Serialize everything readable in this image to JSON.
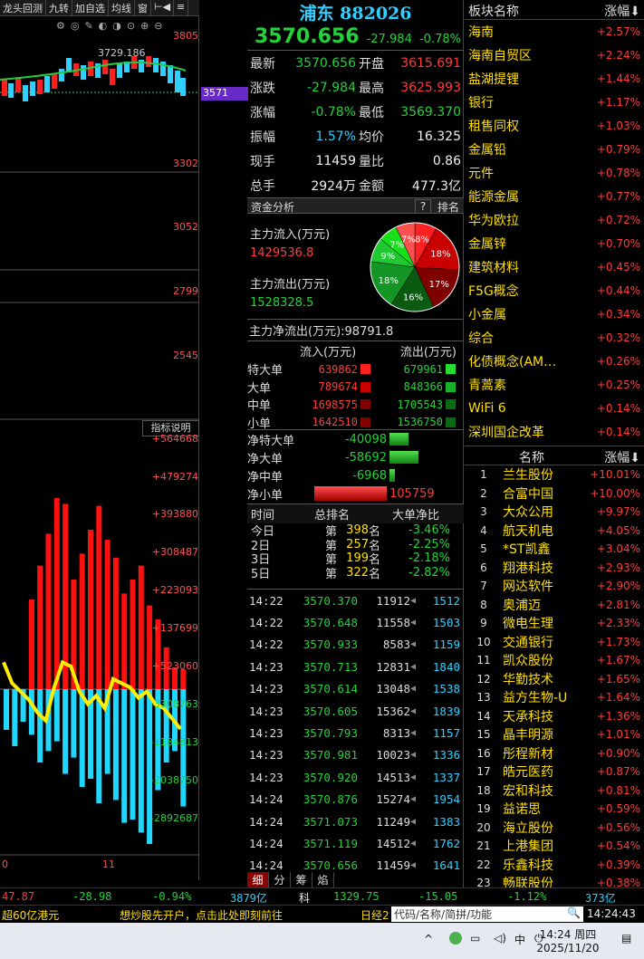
{
  "menu": {
    "items": [
      "龙头回测",
      "九转",
      "加自选",
      "均线",
      "窗",
      "⊢◀",
      "≡"
    ]
  },
  "chart": {
    "price_labels": [
      "3805",
      "3571",
      "3302",
      "3052",
      "2799",
      "2545"
    ],
    "current_tag": "3571",
    "high_label": "3729.186",
    "indicator_btn": "指标说明",
    "flow_labels": [
      "+564668",
      "+479274",
      "+393880",
      "+308487",
      "+223093",
      "+137699",
      "+523060",
      "-3308763",
      "-1184813",
      "-2038750",
      "-2892687"
    ],
    "x_labels": [
      "0",
      "11"
    ],
    "bars": [
      0,
      0,
      0,
      0.45,
      0.62,
      0.78,
      0.96,
      0.93,
      0.55,
      0.68,
      0.8,
      0.92,
      0.75,
      0.66,
      0.48,
      0.55,
      0.62,
      0.42,
      0.35,
      0.21,
      0.11,
      0.1
    ],
    "cbars": [
      0.25,
      0.35,
      0.2,
      0.28,
      0.45,
      0.38,
      0.32,
      0.52,
      0.42,
      0.6,
      0.55,
      0.7,
      0.52,
      0.68,
      0.82,
      0.8,
      0.88,
      0.95,
      0.62,
      0.45,
      0.38,
      0.72
    ],
    "yline": [
      0.58,
      0.68,
      0.72,
      0.76,
      0.82,
      0.86,
      0.7,
      0.58,
      0.6,
      0.72,
      0.78,
      0.74,
      0.8,
      0.66,
      0.68,
      0.7,
      0.75,
      0.72,
      0.78,
      0.8,
      0.85,
      0.9
    ]
  },
  "stock": {
    "name": "浦东",
    "code": "882026",
    "price": "3570.656",
    "change": "-27.984",
    "pct": "-0.78%"
  },
  "quote": [
    {
      "l1": "最新",
      "v1": "3570.656",
      "c1": "green",
      "l2": "开盘",
      "v2": "3615.691",
      "c2": "red"
    },
    {
      "l1": "涨跌",
      "v1": "-27.984",
      "c1": "green",
      "l2": "最高",
      "v2": "3625.993",
      "c2": "red"
    },
    {
      "l1": "涨幅",
      "v1": "-0.78%",
      "c1": "green",
      "l2": "最低",
      "v2": "3569.370",
      "c2": "green"
    },
    {
      "l1": "振幅",
      "v1": "1.57%",
      "c1": "cyan",
      "l2": "均价",
      "v2": "16.325",
      "c2": "white"
    },
    {
      "l1": "现手",
      "v1": "11459",
      "c1": "white",
      "l2": "量比",
      "v2": "0.86",
      "c2": "white"
    },
    {
      "l1": "总手",
      "v1": "2924万",
      "c1": "white",
      "l2": "金额",
      "v2": "477.3亿",
      "c2": "white"
    }
  ],
  "fund": {
    "title": "资金分析",
    "help": "?",
    "rank": "排名",
    "in_label": "主力流入(万元)",
    "in_value": "1429536.8",
    "out_label": "主力流出(万元)",
    "out_value": "1528328.5",
    "net_label": "主力净流出(万元):98791.8",
    "pie": [
      {
        "pct": 8,
        "label": "8%",
        "color": "#ff2020"
      },
      {
        "pct": 18,
        "label": "18%",
        "color": "#c80000"
      },
      {
        "pct": 17,
        "label": "17%",
        "color": "#800000"
      },
      {
        "pct": 16,
        "label": "16%",
        "color": "#0a5a12"
      },
      {
        "pct": 18,
        "label": "18%",
        "color": "#149624"
      },
      {
        "pct": 9,
        "label": "9%",
        "color": "#1fc830"
      },
      {
        "pct": 7,
        "label": "7%",
        "color": "#18e018"
      },
      {
        "pct": 7,
        "label": "7%",
        "color": "#ff5050"
      }
    ]
  },
  "flow": {
    "h_in": "流入(万元)",
    "h_out": "流出(万元)",
    "rows": [
      {
        "l": "特大单",
        "i": "639862",
        "o": "679961"
      },
      {
        "l": "大单",
        "i": "789674",
        "o": "848366"
      },
      {
        "l": "中单",
        "i": "1698575",
        "o": "1705543"
      },
      {
        "l": "小单",
        "i": "1642510",
        "o": "1536750"
      }
    ],
    "net": [
      {
        "l": "净特大单",
        "v": "-40098",
        "w": 0.3,
        "c": "g"
      },
      {
        "l": "净大单",
        "v": "-58692",
        "w": 0.45,
        "c": "g"
      },
      {
        "l": "净中单",
        "v": "-6968",
        "w": 0.05,
        "c": "g"
      },
      {
        "l": "净小单",
        "v": "105759",
        "w": 0.8,
        "c": "r"
      }
    ]
  },
  "rank": {
    "h": [
      "时间",
      "总排名",
      "大单净比"
    ],
    "rows": [
      {
        "t": "今日",
        "n": "398",
        "u": "名",
        "p": "-3.46%"
      },
      {
        "t": "2日",
        "n": "257",
        "u": "名",
        "p": "-2.25%"
      },
      {
        "t": "3日",
        "n": "199",
        "u": "名",
        "p": "-2.18%"
      },
      {
        "t": "5日",
        "n": "322",
        "u": "名",
        "p": "-2.82%"
      }
    ],
    "prefix": "第"
  },
  "ticks": [
    {
      "t": "14:22",
      "p": "3570.370",
      "v": "11912",
      "x": "1512"
    },
    {
      "t": "14:22",
      "p": "3570.648",
      "v": "11558",
      "x": "1503"
    },
    {
      "t": "14:22",
      "p": "3570.933",
      "v": "8583",
      "x": "1159"
    },
    {
      "t": "14:23",
      "p": "3570.713",
      "v": "12831",
      "x": "1840"
    },
    {
      "t": "14:23",
      "p": "3570.614",
      "v": "13048",
      "x": "1538"
    },
    {
      "t": "14:23",
      "p": "3570.605",
      "v": "15362",
      "x": "1839"
    },
    {
      "t": "14:23",
      "p": "3570.793",
      "v": "8313",
      "x": "1157"
    },
    {
      "t": "14:23",
      "p": "3570.981",
      "v": "10023",
      "x": "1336"
    },
    {
      "t": "14:23",
      "p": "3570.920",
      "v": "14513",
      "x": "1337"
    },
    {
      "t": "14:24",
      "p": "3570.876",
      "v": "15274",
      "x": "1954"
    },
    {
      "t": "14:24",
      "p": "3571.073",
      "v": "11249",
      "x": "1383"
    },
    {
      "t": "14:24",
      "p": "3571.119",
      "v": "14512",
      "x": "1762"
    },
    {
      "t": "14:24",
      "p": "3570.656",
      "v": "11459",
      "x": "1641"
    }
  ],
  "subtabs": [
    "细",
    "分",
    "筹",
    "焰"
  ],
  "sectors": {
    "h1": "板块名称",
    "h2": "涨幅",
    "rows": [
      {
        "n": "海南",
        "p": "+2.57%"
      },
      {
        "n": "海南自贸区",
        "p": "+2.24%"
      },
      {
        "n": "盐湖提锂",
        "p": "+1.44%"
      },
      {
        "n": "银行",
        "p": "+1.17%"
      },
      {
        "n": "租售同权",
        "p": "+1.03%"
      },
      {
        "n": "金属铅",
        "p": "+0.79%"
      },
      {
        "n": "元件",
        "p": "+0.78%"
      },
      {
        "n": "能源金属",
        "p": "+0.77%"
      },
      {
        "n": "华为欧拉",
        "p": "+0.72%"
      },
      {
        "n": "金属锌",
        "p": "+0.70%"
      },
      {
        "n": "建筑材料",
        "p": "+0.45%"
      },
      {
        "n": "F5G概念",
        "p": "+0.44%"
      },
      {
        "n": "小金属",
        "p": "+0.34%"
      },
      {
        "n": "综合",
        "p": "+0.32%"
      },
      {
        "n": "化债概念(AM…",
        "p": "+0.26%"
      },
      {
        "n": "青蒿素",
        "p": "+0.25%"
      },
      {
        "n": "WiFi 6",
        "p": "+0.14%"
      },
      {
        "n": "深圳国企改革",
        "p": "+0.14%"
      }
    ]
  },
  "stocks": {
    "h1": "名称",
    "h2": "涨幅",
    "rows": [
      {
        "i": "1",
        "n": "兰生股份",
        "p": "+10.01%"
      },
      {
        "i": "2",
        "n": "合富中国",
        "p": "+10.00%"
      },
      {
        "i": "3",
        "n": "大众公用",
        "p": "+9.97%"
      },
      {
        "i": "4",
        "n": "航天机电",
        "p": "+4.05%"
      },
      {
        "i": "5",
        "n": "*ST凯鑫",
        "p": "+3.04%"
      },
      {
        "i": "6",
        "n": "翔港科技",
        "p": "+2.93%"
      },
      {
        "i": "7",
        "n": "网达软件",
        "p": "+2.90%"
      },
      {
        "i": "8",
        "n": "奥浦迈",
        "p": "+2.81%"
      },
      {
        "i": "9",
        "n": "微电生理",
        "p": "+2.33%"
      },
      {
        "i": "10",
        "n": "交通银行",
        "p": "+1.73%"
      },
      {
        "i": "11",
        "n": "凯众股份",
        "p": "+1.67%"
      },
      {
        "i": "12",
        "n": "华勤技术",
        "p": "+1.65%"
      },
      {
        "i": "13",
        "n": "益方生物-U",
        "p": "+1.64%"
      },
      {
        "i": "14",
        "n": "天承科技",
        "p": "+1.36%"
      },
      {
        "i": "15",
        "n": "晶丰明源",
        "p": "+1.01%"
      },
      {
        "i": "16",
        "n": "彤程新材",
        "p": "+0.90%"
      },
      {
        "i": "17",
        "n": "皓元医药",
        "p": "+0.87%"
      },
      {
        "i": "18",
        "n": "宏和科技",
        "p": "+0.81%"
      },
      {
        "i": "19",
        "n": "益诺思",
        "p": "+0.59%"
      },
      {
        "i": "20",
        "n": "海立股份",
        "p": "+0.56%"
      },
      {
        "i": "21",
        "n": "上港集团",
        "p": "+0.54%"
      },
      {
        "i": "22",
        "n": "乐鑫科技",
        "p": "+0.39%"
      },
      {
        "i": "23",
        "n": "畅联股份",
        "p": "+0.38%"
      }
    ]
  },
  "status": {
    "a": "47.87",
    "b": "-28.98",
    "c": "-0.94%",
    "d": "3879亿",
    "e": "科",
    "f": "1329.75",
    "g": "-15.05",
    "h": "-1.12%",
    "i": "373亿"
  },
  "news": {
    "left": "超60亿港元",
    "mid": "想炒股先开户，点击此处即刻前往",
    "right": "日经2",
    "search": "代码/名称/简拼/功能",
    "time": "14:24:43"
  },
  "taskbar": {
    "time": "14:24 周四",
    "date": "2025/11/20",
    "ime": "中"
  }
}
